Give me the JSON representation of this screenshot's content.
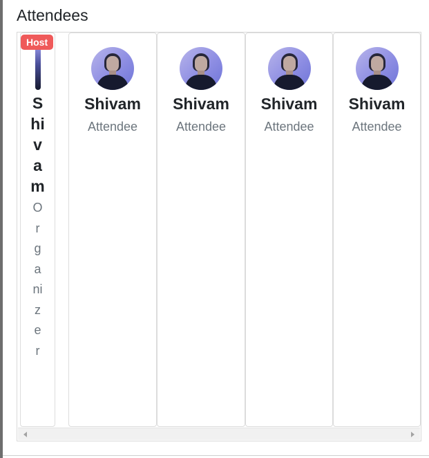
{
  "section": {
    "title": "Attendees"
  },
  "host": {
    "badge": "Host",
    "name": "Shivam",
    "role": "Organizer"
  },
  "attendees": [
    {
      "name": "Shivam",
      "role": "Attendee"
    },
    {
      "name": "Shivam",
      "role": "Attendee"
    },
    {
      "name": "Shivam",
      "role": "Attendee"
    },
    {
      "name": "Shivam",
      "role": "Attendee"
    }
  ],
  "colors": {
    "badge": "#ef5a5a",
    "text": "#212529",
    "muted": "#6c757d",
    "border": "#dcdcdc"
  }
}
